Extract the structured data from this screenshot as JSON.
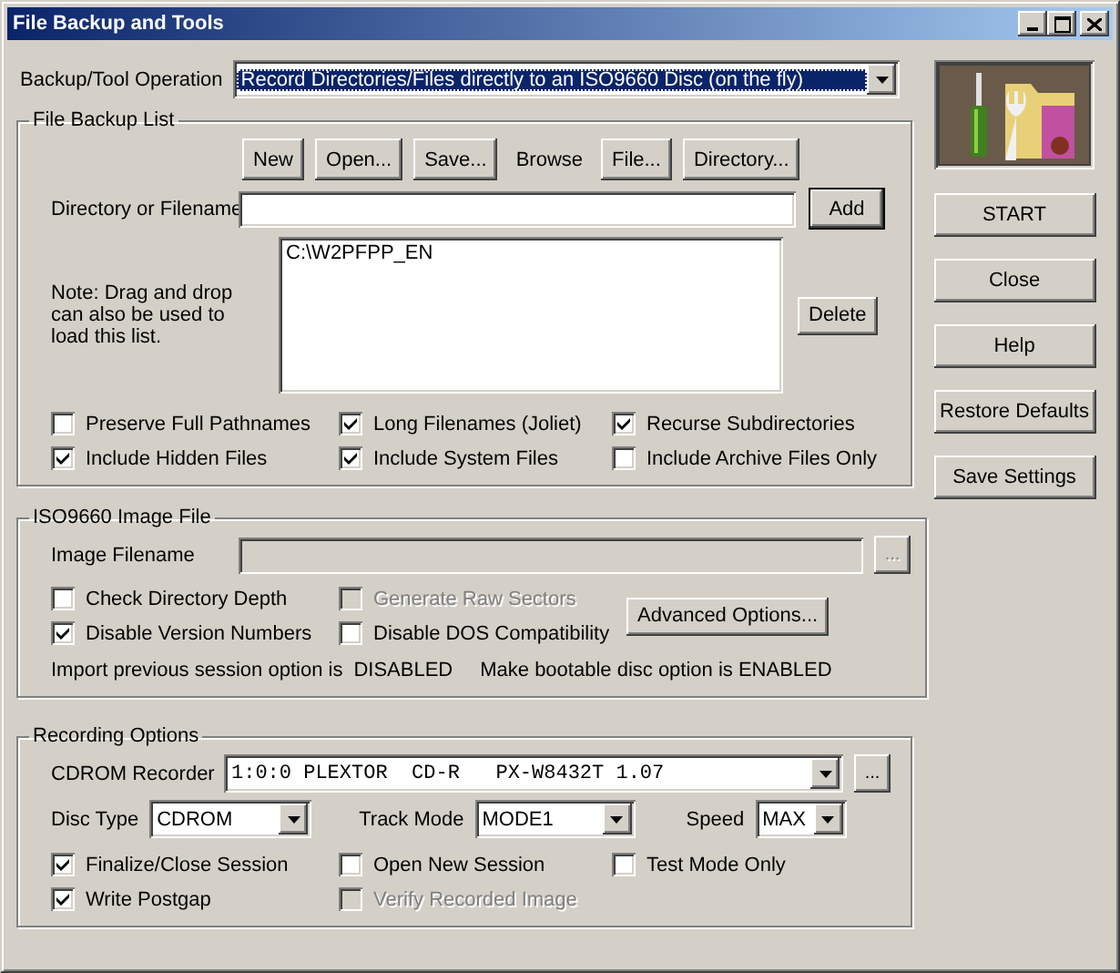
{
  "window": {
    "title": "File Backup and Tools"
  },
  "operation": {
    "label": "Backup/Tool Operation",
    "value": "Record Directories/Files directly to an ISO9660 Disc (on the fly)",
    "focused": true
  },
  "file_backup_list": {
    "title": "File Backup List",
    "buttons": [
      "New",
      "Open...",
      "Save..."
    ],
    "browse_label": "Browse",
    "browse_buttons": [
      "File...",
      "Directory..."
    ],
    "entry": {
      "label": "Directory or Filename"
    },
    "add_button": "Add",
    "note": "Note: Drag and drop can also be used to load this list.",
    "items": [
      "C:\\W2PFPP_EN"
    ],
    "delete_button": "Delete",
    "options": [
      {
        "label": "Preserve Full Pathnames",
        "checked": false
      },
      {
        "label": "Long Filenames (Joliet)",
        "checked": true
      },
      {
        "label": "Recurse Subdirectories",
        "checked": true
      },
      {
        "label": "Include Hidden Files",
        "checked": true
      },
      {
        "label": "Include System Files",
        "checked": true
      },
      {
        "label": "Include Archive Files Only",
        "checked": false
      }
    ]
  },
  "iso_image": {
    "title": "ISO9660 Image File",
    "image_filename": {
      "label": "Image Filename",
      "disabled": true
    },
    "browse_button": "...",
    "options": [
      {
        "label": "Check Directory Depth",
        "checked": false,
        "disabled": false
      },
      {
        "label": "Generate Raw Sectors",
        "checked": false,
        "disabled": true
      },
      {
        "label": "Disable Version Numbers",
        "checked": true,
        "disabled": false
      },
      {
        "label": "Disable DOS Compatibility",
        "checked": false,
        "disabled": false
      }
    ],
    "advanced_button": "Advanced Options...",
    "status": [
      "Import previous session option is",
      "DISABLED",
      "Make bootable disc option is ENABLED"
    ]
  },
  "recording": {
    "title": "Recording Options",
    "recorder": {
      "label": "CDROM Recorder",
      "value": "1:0:0 PLEXTOR  CD-R   PX-W8432T 1.07"
    },
    "browse_button": "...",
    "disc_type": {
      "label": "Disc Type",
      "value": "CDROM"
    },
    "track_mode": {
      "label": "Track Mode",
      "value": "MODE1"
    },
    "speed": {
      "label": "Speed",
      "value": "MAX"
    },
    "options": [
      {
        "label": "Finalize/Close Session",
        "checked": true,
        "disabled": false
      },
      {
        "label": "Open New Session",
        "checked": false,
        "disabled": false
      },
      {
        "label": "Test Mode Only",
        "checked": false,
        "disabled": false
      },
      {
        "label": "Write Postgap",
        "checked": true,
        "disabled": false
      },
      {
        "label": "Verify Recorded Image",
        "checked": false,
        "disabled": true
      }
    ]
  },
  "side_buttons": [
    {
      "label": "START"
    },
    {
      "label": "Close"
    },
    {
      "label": "Help"
    },
    {
      "label": "Restore Defaults"
    },
    {
      "label": "Save Settings"
    }
  ]
}
